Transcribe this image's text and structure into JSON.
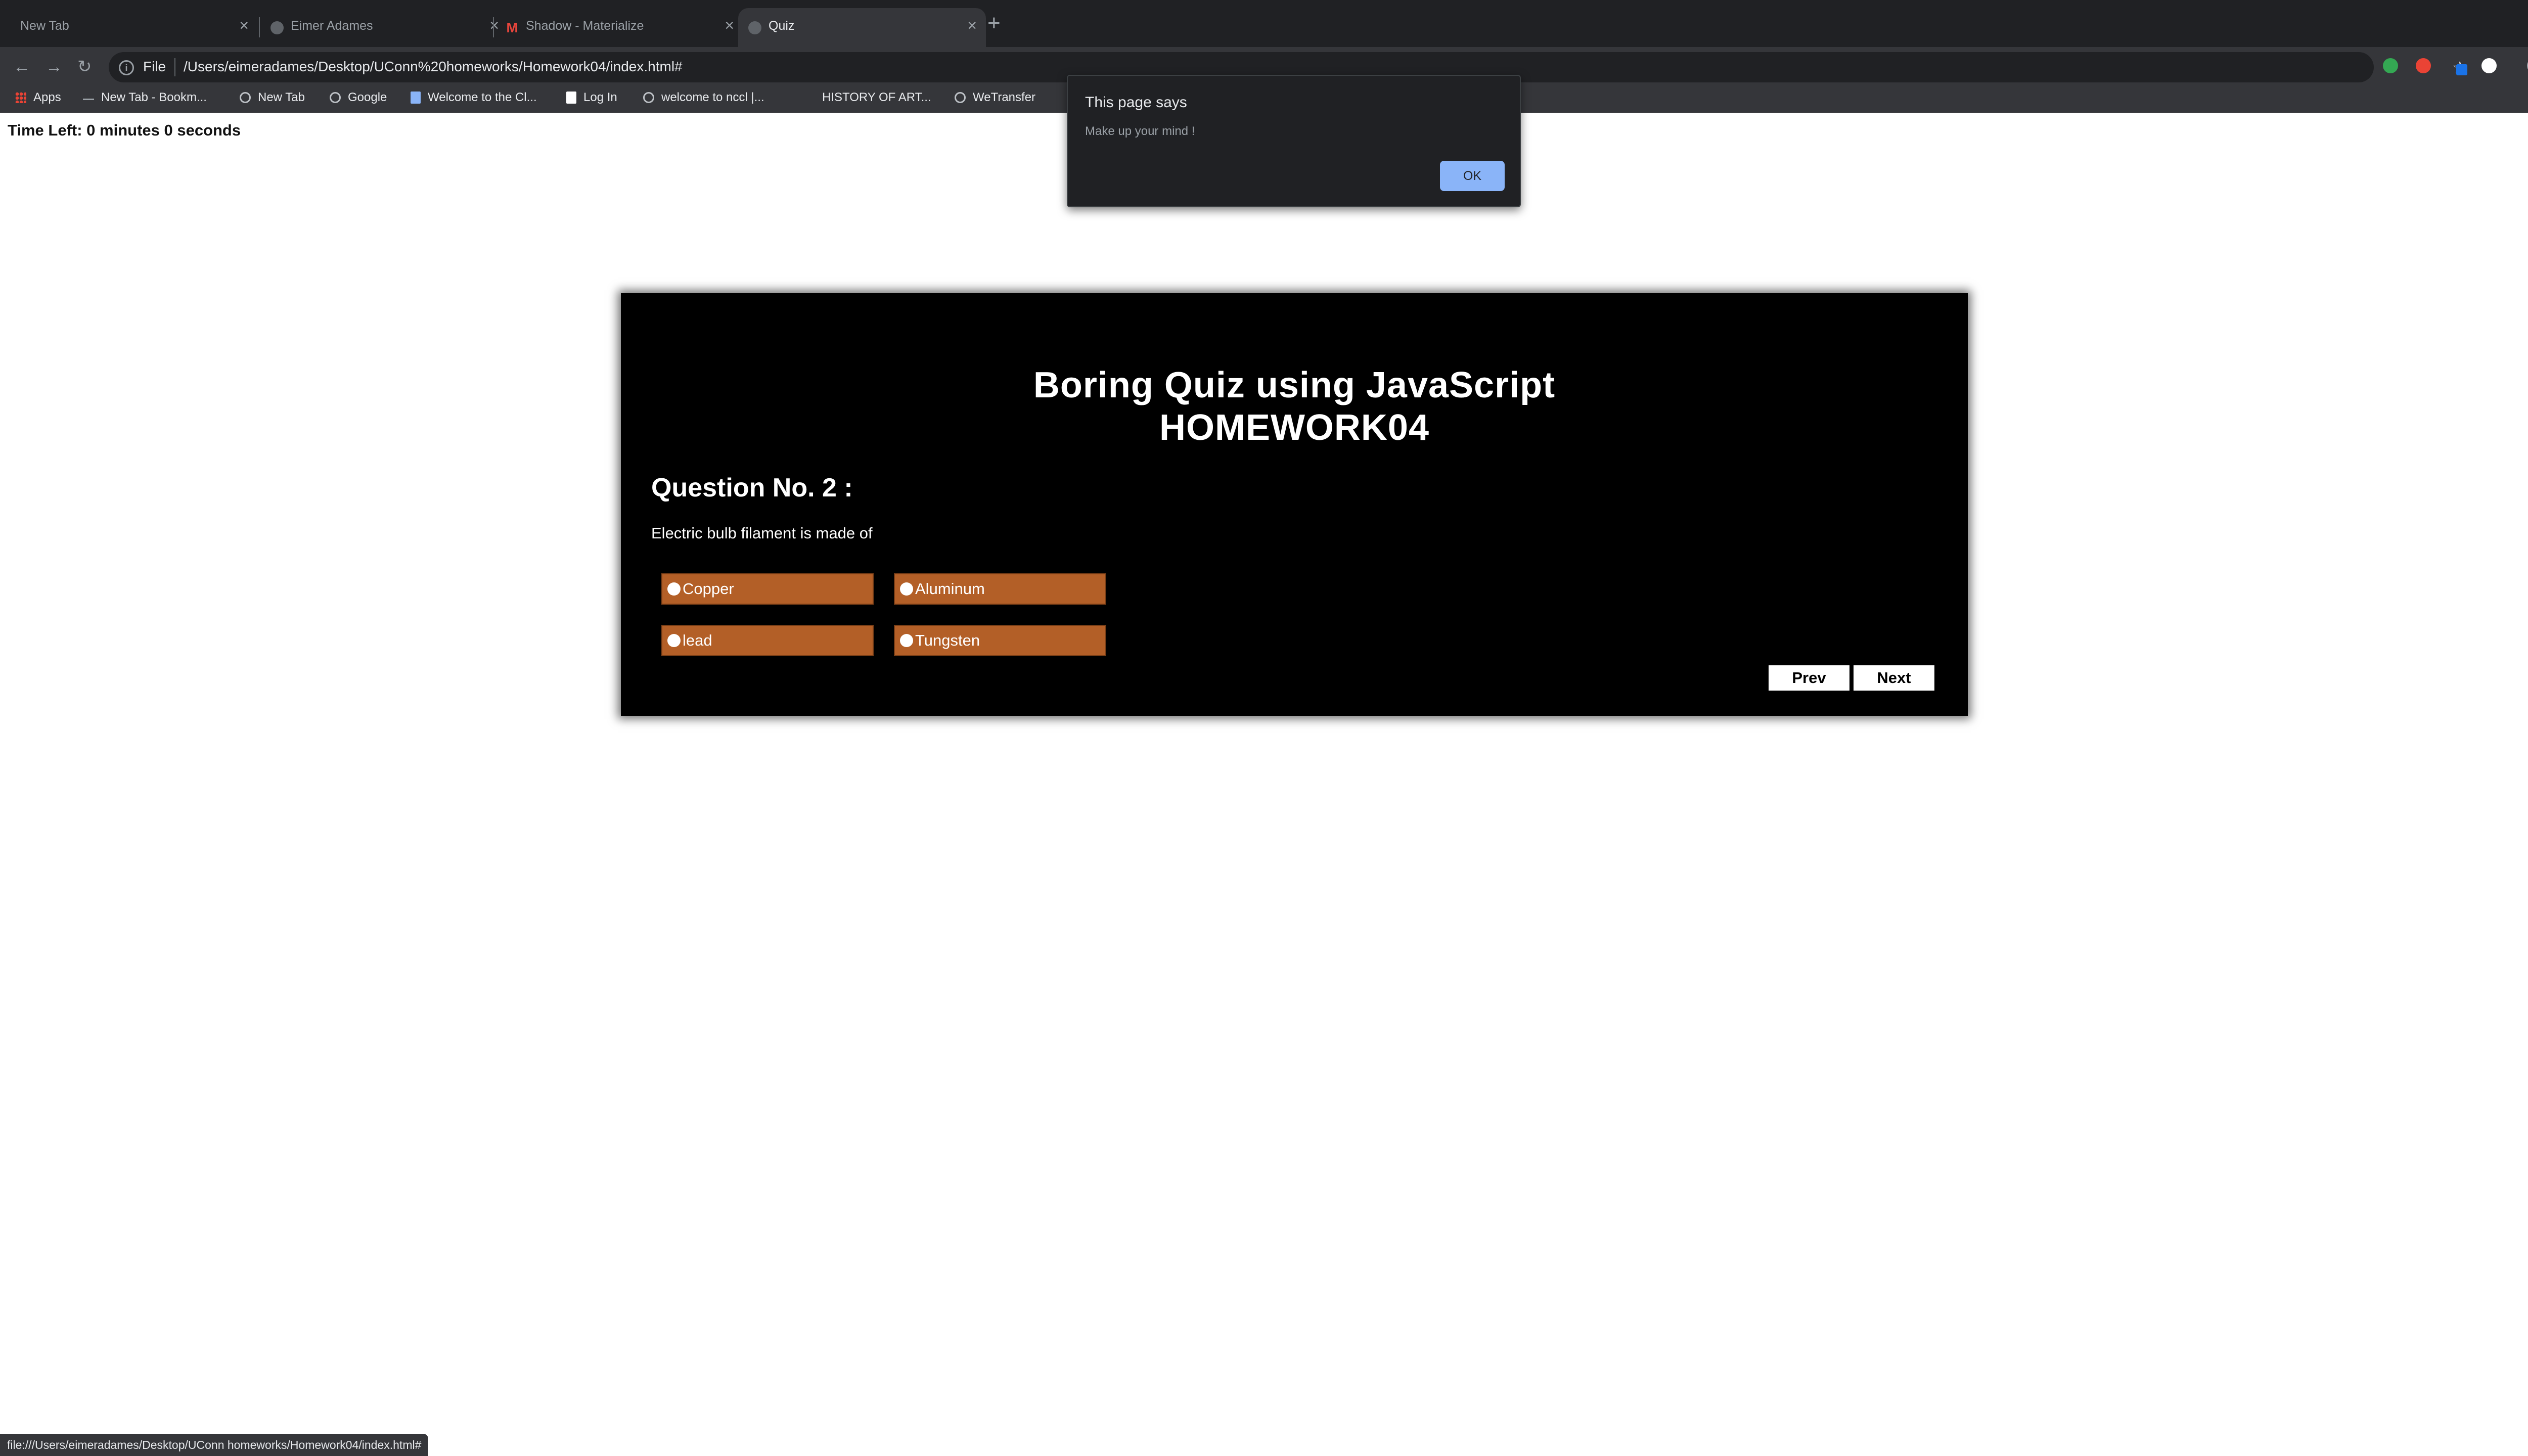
{
  "browser": {
    "tabs": [
      {
        "title": "New Tab",
        "active": false
      },
      {
        "title": "Eimer Adames",
        "active": false
      },
      {
        "title": "Shadow - Materialize",
        "active": false
      },
      {
        "title": "Quiz",
        "active": true
      }
    ],
    "new_tab_symbol": "+",
    "address": {
      "scheme_label": "File",
      "url": "/Users/eimeradames/Desktop/UConn%20homeworks/Homework04/index.html#"
    },
    "bookmarks": [
      {
        "label": "Apps",
        "icon": "apps-grid-icon"
      },
      {
        "label": "New Tab - Bookm...",
        "icon": "dash-icon"
      },
      {
        "label": "New Tab",
        "icon": "globe-icon"
      },
      {
        "label": "Google",
        "icon": "globe-icon"
      },
      {
        "label": "Welcome to the Cl...",
        "icon": "page-icon"
      },
      {
        "label": "Log In",
        "icon": "doc-icon"
      },
      {
        "label": "welcome to nccl |...",
        "icon": "globe-icon"
      },
      {
        "label": "HISTORY OF ART...",
        "icon": "none"
      },
      {
        "label": "WeTransfer",
        "icon": "globe-icon"
      }
    ]
  },
  "page": {
    "timer": "Time Left: 0 minutes 0 seconds",
    "quiz": {
      "title_line1": "Boring Quiz using JavaScript",
      "title_line2": "HOMEWORK04",
      "question_heading": "Question No. 2 :",
      "question_text": "Electric bulb filament is made of",
      "options": [
        "Copper",
        "Aluminum",
        "lead",
        "Tungsten"
      ],
      "prev_label": "Prev",
      "next_label": "Next",
      "option_color": "#b35f27"
    }
  },
  "dialog": {
    "title": "This page says",
    "message": "Make up your mind !",
    "ok_label": "OK"
  },
  "status_bar": "file:///Users/eimeradames/Desktop/UConn homeworks/Homework04/index.html#"
}
